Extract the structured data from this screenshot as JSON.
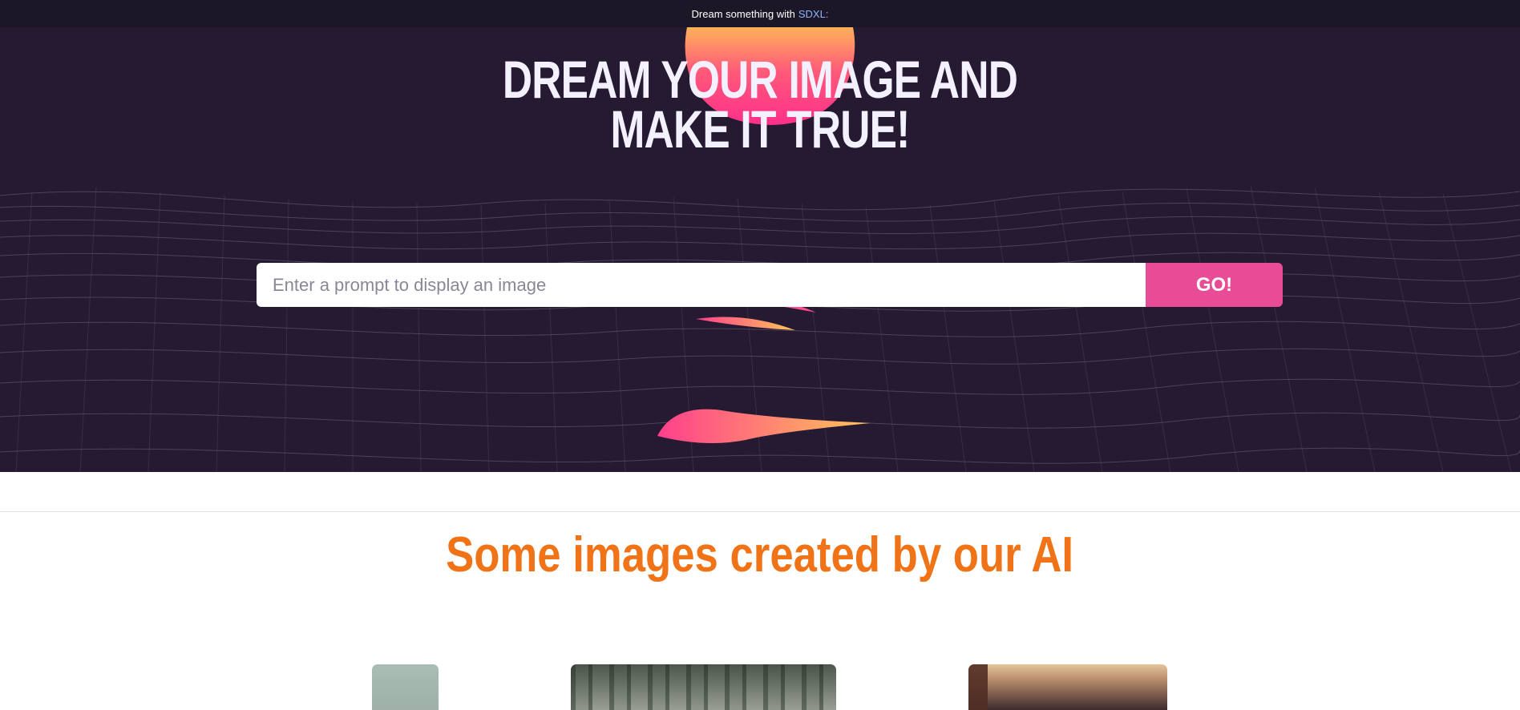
{
  "topbar": {
    "text": "Dream something with",
    "link": "SDXL:"
  },
  "hero": {
    "headline_line1": "DREAM YOUR IMAGE AND",
    "headline_line2": "MAKE IT TRUE!"
  },
  "search": {
    "placeholder": "Enter a prompt to display an image",
    "value": "",
    "button_label": "GO!"
  },
  "gallery": {
    "title": "Some images created by our AI",
    "images": [
      {
        "name": "gallery-image-1"
      },
      {
        "name": "gallery-image-2"
      },
      {
        "name": "gallery-image-3"
      }
    ]
  },
  "colors": {
    "hero_bg": "#251a32",
    "topbar_bg": "#1b1726",
    "accent_pink": "#e94c97",
    "title_orange": "#f07417",
    "link_blue": "#8fb4ff"
  }
}
